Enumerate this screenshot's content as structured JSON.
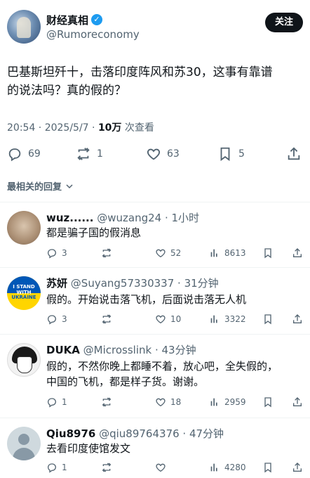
{
  "post": {
    "author_name": "财经真相",
    "author_handle": "@Rumoreconomy",
    "follow_label": "关注",
    "text_line1": "巴基斯坦歼十，击落印度阵风和苏30，这事有靠谱",
    "text_line2": "的说法吗？真的假的？",
    "time": "20:54 · 2025/5/7 · ",
    "views_count": "10万",
    "views_label": " 次查看",
    "replies": "69",
    "reposts": "1",
    "likes": "63",
    "bookmarks": "5"
  },
  "sort_label": "最相关的回复",
  "replies": [
    {
      "name": "wuz......",
      "handle": "@wuzang24 · 1小时",
      "text1": "都是骗子国的假消息",
      "text2": "",
      "replies": "3",
      "reposts": "",
      "likes": "52",
      "views": "8613"
    },
    {
      "name": "苏妍",
      "handle": "@Suyang57330337 · 31分钟",
      "text1": "假的。开始说击落飞机，后面说击落无人机",
      "text2": "",
      "replies": "3",
      "reposts": "",
      "likes": "10",
      "views": "3322",
      "avatar_text1": "I STAND WITH",
      "avatar_text2": "UKRAINE"
    },
    {
      "name": "DUKA",
      "handle": "@Microsslink · 43分钟",
      "text1": "假的，不然你晚上都睡不着，放心吧，全失假的，",
      "text2": "中国的飞机，都是样子货。谢谢。",
      "replies": "1",
      "reposts": "",
      "likes": "18",
      "views": "2959"
    },
    {
      "name": "Qiu8976",
      "handle": "@qiu89764376 · 47分钟",
      "text1": "去看印度使馆发文",
      "text2": "",
      "replies": "1",
      "reposts": "",
      "likes": "",
      "views": "4280"
    }
  ],
  "colors": {
    "accent": "#1d9bf0",
    "muted": "#536471",
    "text": "#0f1419"
  }
}
